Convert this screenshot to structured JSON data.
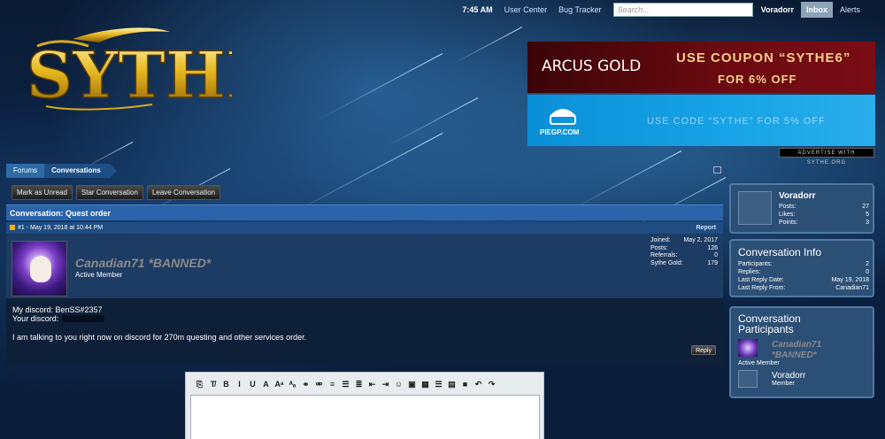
{
  "topbar": {
    "time": "7:45 AM",
    "links": [
      "User Center",
      "Bug Tracker"
    ],
    "search_placeholder": "Search...",
    "username": "Voradorr",
    "inbox": "Inbox",
    "alerts": "Alerts"
  },
  "logo": {
    "text": "SYTHE"
  },
  "ads": {
    "ad1": {
      "brand": "ARCUS GOLD",
      "coupon": "USE COUPON “SYTHE6”",
      "offer": "FOR 6% OFF"
    },
    "ad2": {
      "brand": "PIEGP.COM",
      "code": "USE CODE “SYTHE” FOR 5% OFF"
    },
    "advertise": "ADVERTISE WITH SYTHE.ORG"
  },
  "breadcrumb": [
    "Forums",
    "Conversations"
  ],
  "actions": [
    "Mark as Unread",
    "Star Conversation",
    "Leave Conversation"
  ],
  "conversation": {
    "title": "Conversation: Quest order",
    "message": {
      "header": "#1 - May 19, 2018 at 10:44 PM",
      "report": "Report",
      "author": "Canadian71 *BANNED*",
      "rank": "Active Member",
      "stats": [
        {
          "label": "Joined:",
          "value": "May 2, 2017"
        },
        {
          "label": "Posts:",
          "value": "126"
        },
        {
          "label": "Referrals:",
          "value": "0"
        },
        {
          "label": "Sythe Gold:",
          "value": "179"
        }
      ],
      "line1": "My discord: BenSS#2357",
      "line2": "Your discord:",
      "line3": "I am talking to you right now on discord for 270m questing and other services order.",
      "reply": "Reply"
    }
  },
  "editor": {
    "tools": [
      "remove-format-icon",
      "clear-icon",
      "bold-icon",
      "italic-icon",
      "underline-icon",
      "font-color-icon",
      "font-size-icon",
      "font-family-icon",
      "link-icon",
      "unlink-icon",
      "align-icon",
      "bullet-list-icon",
      "numbered-list-icon",
      "outdent-icon",
      "indent-icon",
      "smilies-icon",
      "image-icon",
      "media-icon",
      "code-icon",
      "spoiler-icon",
      "save-icon",
      "undo-icon",
      "redo-icon"
    ],
    "tool_glyphs": [
      "⎘",
      "T̸",
      "B",
      "I",
      "U",
      "A",
      "Aᵃ",
      "ᴬₐ",
      "⚭",
      "⚮",
      "≡",
      "☰",
      "≣",
      "⇤",
      "⇥",
      "☺",
      "▣",
      "▦",
      "☰",
      "▤",
      "■",
      "↶",
      "↷"
    ]
  },
  "sidebar": {
    "user": {
      "name": "Voradorr",
      "stats": [
        {
          "label": "Posts:",
          "value": "27"
        },
        {
          "label": "Likes:",
          "value": "5"
        },
        {
          "label": "Points:",
          "value": "3"
        }
      ]
    },
    "info": {
      "title": "Conversation Info",
      "rows": [
        {
          "label": "Participants:",
          "value": "2"
        },
        {
          "label": "Replies:",
          "value": "0"
        },
        {
          "label": "Last Reply Date:",
          "value": "May 19, 2018"
        },
        {
          "label": "Last Reply From:",
          "value": "Canadian71"
        }
      ]
    },
    "participants": {
      "title_line1": "Conversation",
      "title_line2": "Participants",
      "list": [
        {
          "name_line1": "Canadian71",
          "name_line2": "*BANNED*",
          "rank": "Active Member"
        },
        {
          "name_line1": "Voradorr",
          "name_line2": "",
          "rank": "Member"
        }
      ]
    }
  }
}
